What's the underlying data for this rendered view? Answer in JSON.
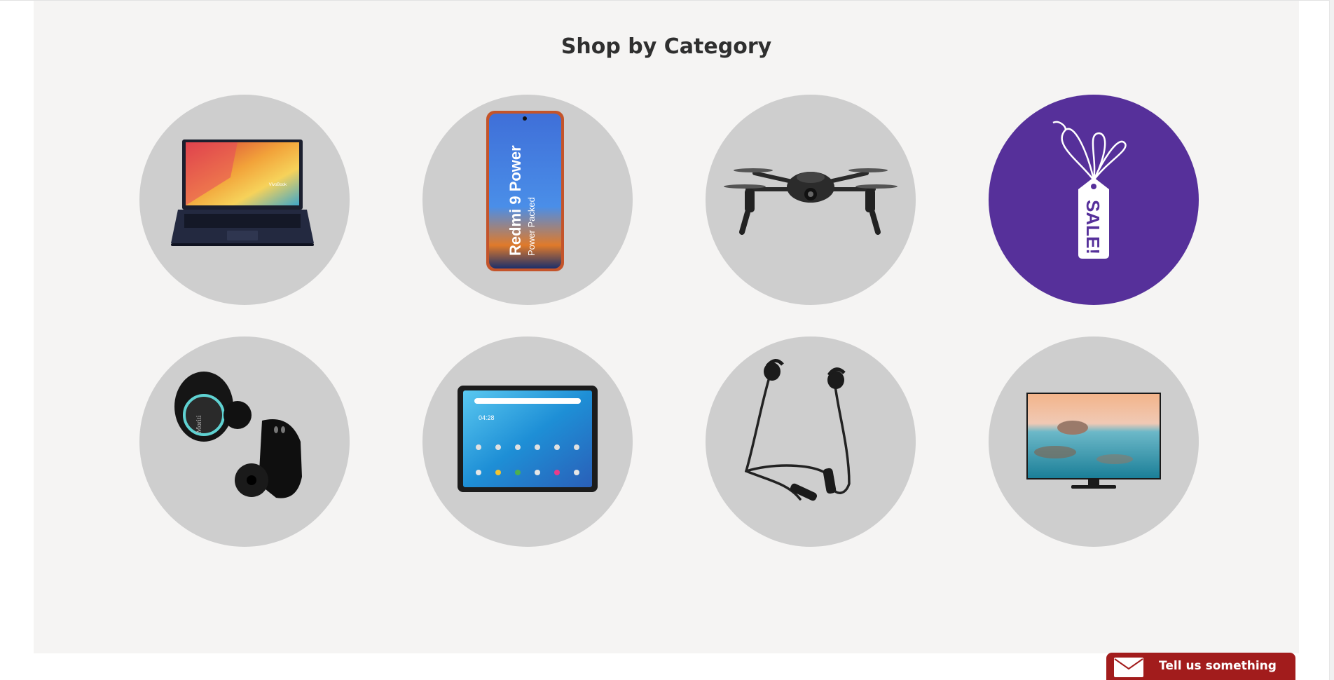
{
  "section": {
    "title": "Shop by Category",
    "background_color": "#f5f4f3",
    "tile_color": "#cecece",
    "categories": [
      {
        "icon": "laptop-icon",
        "brand_text": "VivoBook"
      },
      {
        "icon": "smartphone-icon",
        "model_text": "Redmi 9 Power",
        "tagline": "Power Packed"
      },
      {
        "icon": "drone-icon"
      },
      {
        "icon": "sale-tag-icon",
        "tag_text": "SALE!",
        "background_color": "#56309a"
      },
      {
        "icon": "earbuds-icon",
        "brand_text": "Moriti"
      },
      {
        "icon": "tablet-icon",
        "clock_text": "04:28"
      },
      {
        "icon": "neckband-earphones-icon"
      },
      {
        "icon": "television-icon"
      }
    ]
  },
  "feedback": {
    "label": "Tell us something",
    "icon": "envelope-icon",
    "background_color": "#a21c1c"
  }
}
